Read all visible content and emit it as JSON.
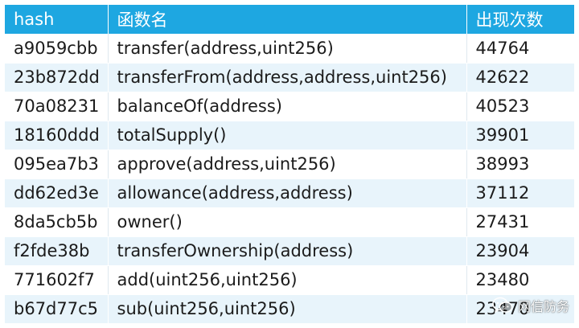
{
  "table": {
    "headers": [
      "hash",
      "函数名",
      "出现次数"
    ],
    "rows": [
      {
        "hash": "a9059cbb",
        "name": "transfer(address,uint256)",
        "count": "44764"
      },
      {
        "hash": "23b872dd",
        "name": "transferFrom(address,address,uint256)",
        "count": "42622"
      },
      {
        "hash": "70a08231",
        "name": "balanceOf(address)",
        "count": "40523"
      },
      {
        "hash": "18160ddd",
        "name": "totalSupply()",
        "count": "39901"
      },
      {
        "hash": "095ea7b3",
        "name": "approve(address,uint256)",
        "count": "38993"
      },
      {
        "hash": "dd62ed3e",
        "name": "allowance(address,address)",
        "count": "37112"
      },
      {
        "hash": "8da5cb5b",
        "name": "owner()",
        "count": "27431"
      },
      {
        "hash": "f2fde38b",
        "name": "transferOwnership(address)",
        "count": "23904"
      },
      {
        "hash": "771602f7",
        "name": "add(uint256,uint256)",
        "count": "23480"
      },
      {
        "hash": "b67d77c5",
        "name": "sub(uint256,uint256)",
        "count": "23470"
      }
    ]
  },
  "watermark": {
    "text": "网信防务",
    "icon": "wechat-icon"
  },
  "colors": {
    "header_bg": "#1ea7e1",
    "alt_row_bg": "#e8f4fb"
  }
}
